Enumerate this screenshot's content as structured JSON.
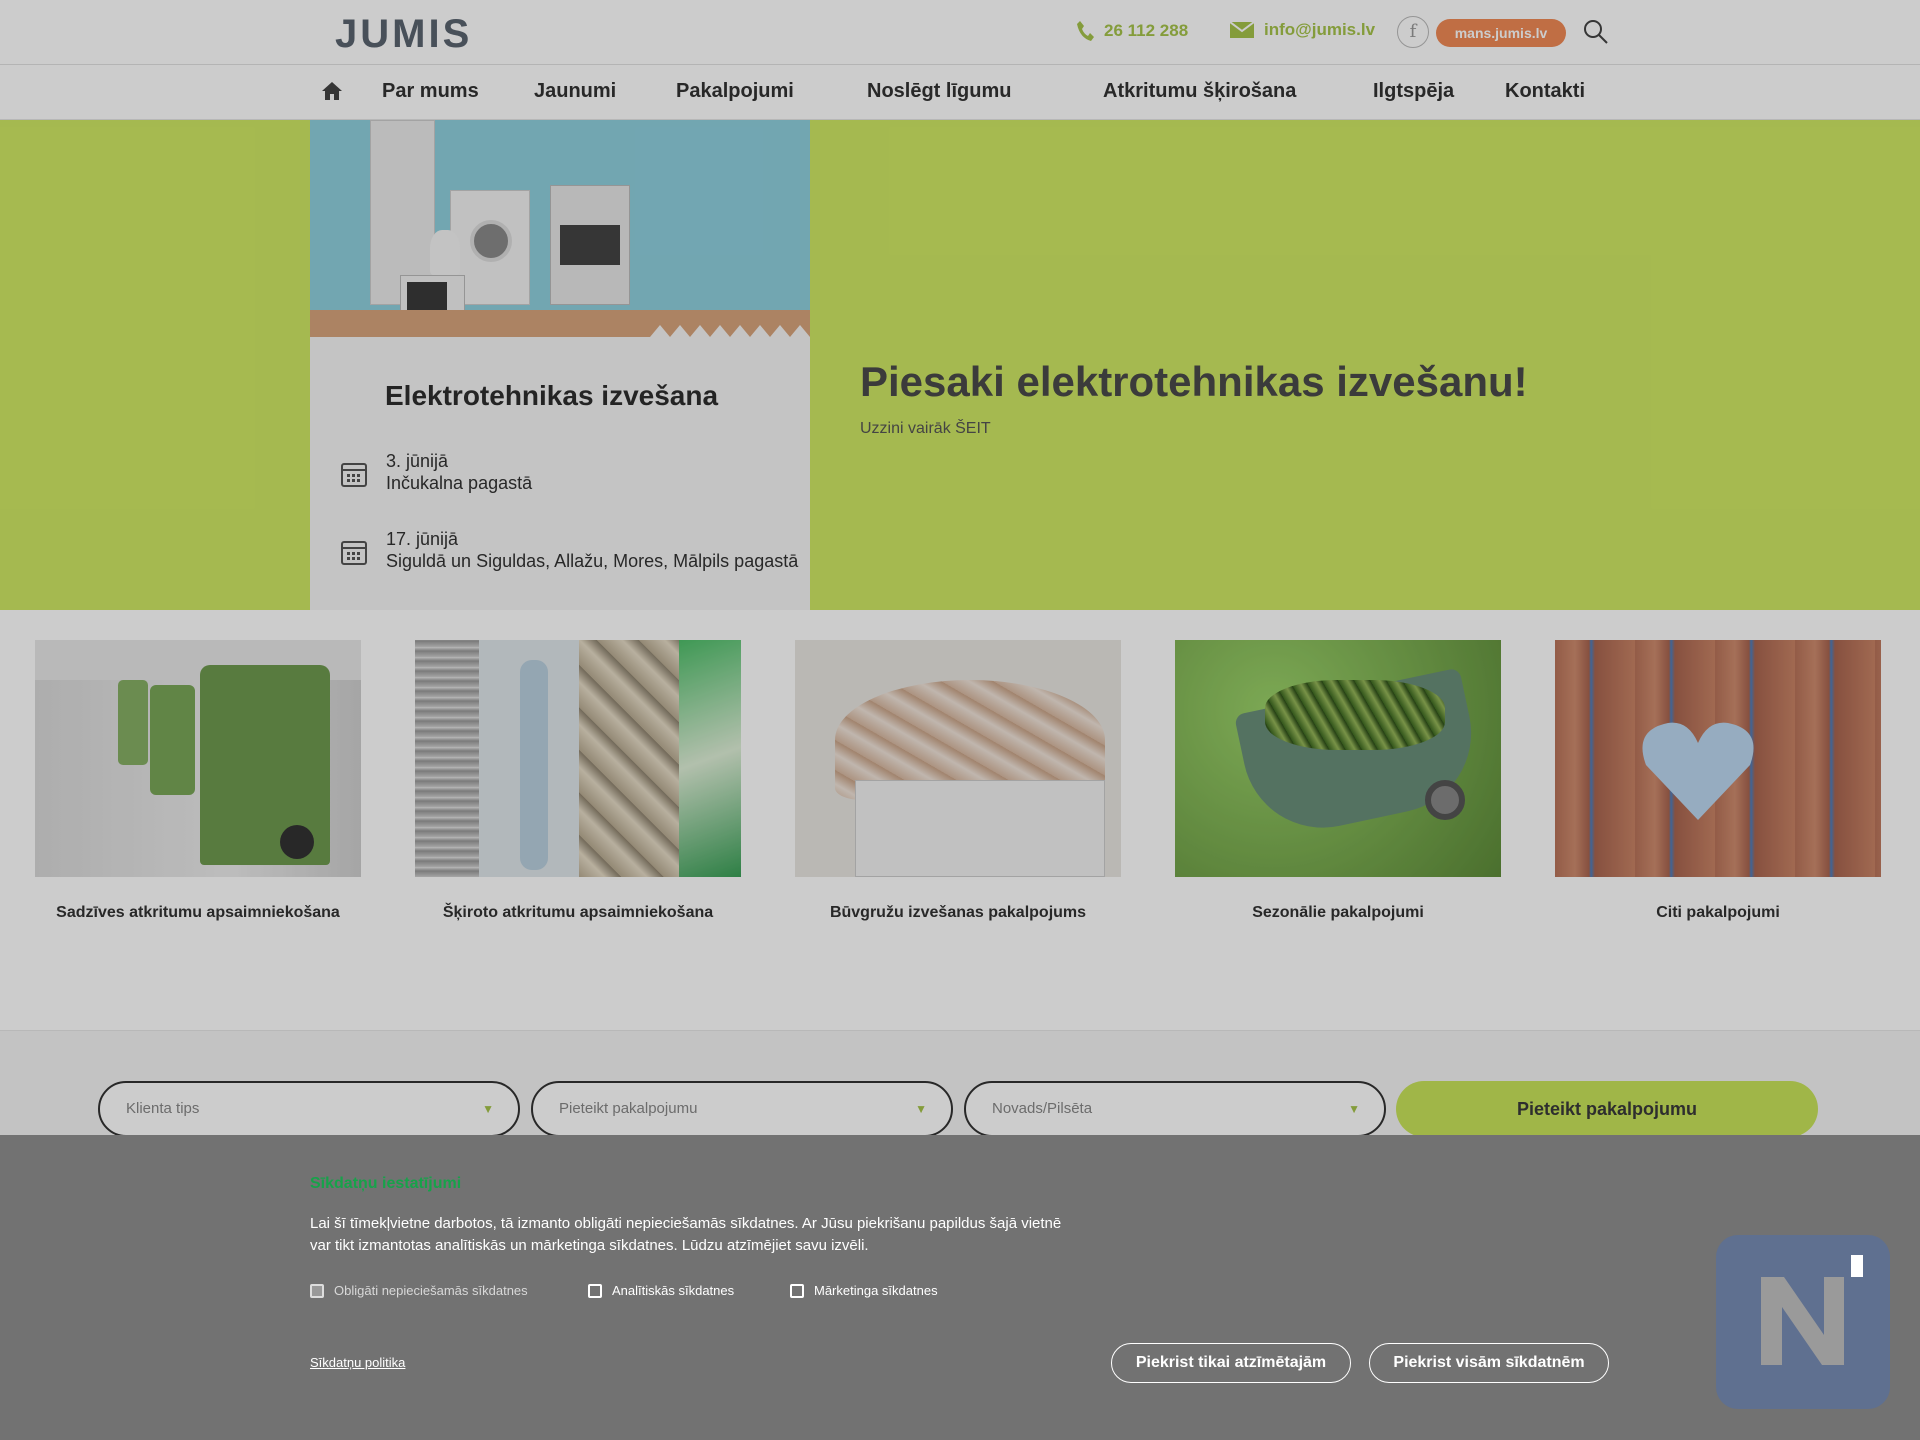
{
  "header": {
    "logo_text": "JUMIS",
    "phone": "26 112 288",
    "email": "info@jumis.lv",
    "facebook": "f",
    "portal_label": "mans.jumis.lv"
  },
  "nav": {
    "items": [
      "Par mums",
      "Jaunumi",
      "Pakalpojumi",
      "Noslēgt līgumu",
      "Atkritumu šķirošana",
      "Ilgtspēja",
      "Kontakti"
    ]
  },
  "hero": {
    "poster_title": "Elektrotehnikas izvešana",
    "events": [
      {
        "date": "3. jūnijā",
        "place": "Inčukalna pagastā"
      },
      {
        "date": "17. jūnijā",
        "place": "Siguldā un Siguldas, Allažu, Mores, Mālpils pagastā"
      }
    ],
    "title": "Piesaki elektrotehnikas izvešanu!",
    "subtitle": "Uzzini vairāk ŠEIT"
  },
  "services": [
    {
      "label": "Sadzīves atkritumu apsaimniekošana"
    },
    {
      "label": "Šķiroto atkritumu apsaimniekošana"
    },
    {
      "label": "Būvgružu izvešanas pakalpojums"
    },
    {
      "label": "Sezonālie pakalpojumi"
    },
    {
      "label": "Citi pakalpojumi"
    }
  ],
  "order": {
    "client_type_placeholder": "Klienta tips",
    "service_placeholder": "Pieteikt pakalpojumu",
    "region_placeholder": "Novads/Pilsēta",
    "submit_label": "Pieteikt pakalpojumu"
  },
  "cookies": {
    "title": "Sīkdatņu iestatījumi",
    "description": "Lai šī tīmekļvietne darbotos, tā izmanto obligāti nepieciešamās sīkdatnes. Ar Jūsu piekrišanu papildus šajā vietnē var tikt izmantotas analītiskās un mārketinga sīkdatnes. Lūdzu atzīmējiet savu izvēli.",
    "options": [
      {
        "label": "Obligāti nepieciešamās sīkdatnes",
        "checked": true,
        "disabled": true
      },
      {
        "label": "Analītiskās sīkdatnes",
        "checked": false,
        "disabled": false
      },
      {
        "label": "Mārketinga sīkdatnes",
        "checked": false,
        "disabled": false
      }
    ],
    "policy_link": "Sīkdatņu politika",
    "accept_selected": "Piekrist tikai atzīmētajām",
    "accept_all": "Piekrist visām sīkdatnēm"
  },
  "colors": {
    "brand_green": "#cfe864",
    "accent_orange": "#f08a56",
    "cookie_bg": "#727272"
  }
}
